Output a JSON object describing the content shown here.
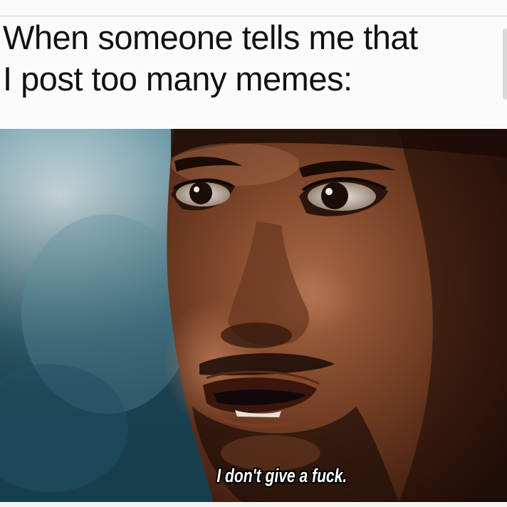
{
  "meme": {
    "caption_line_1": "When someone tells me that",
    "caption_line_2": "I post too many memes:",
    "subtitle": "I don't give a fuck."
  },
  "colors": {
    "caption_text": "#111111",
    "background": "#fbfbfb",
    "subtitle_text": "#ffffff",
    "subtitle_outline": "#000000"
  }
}
